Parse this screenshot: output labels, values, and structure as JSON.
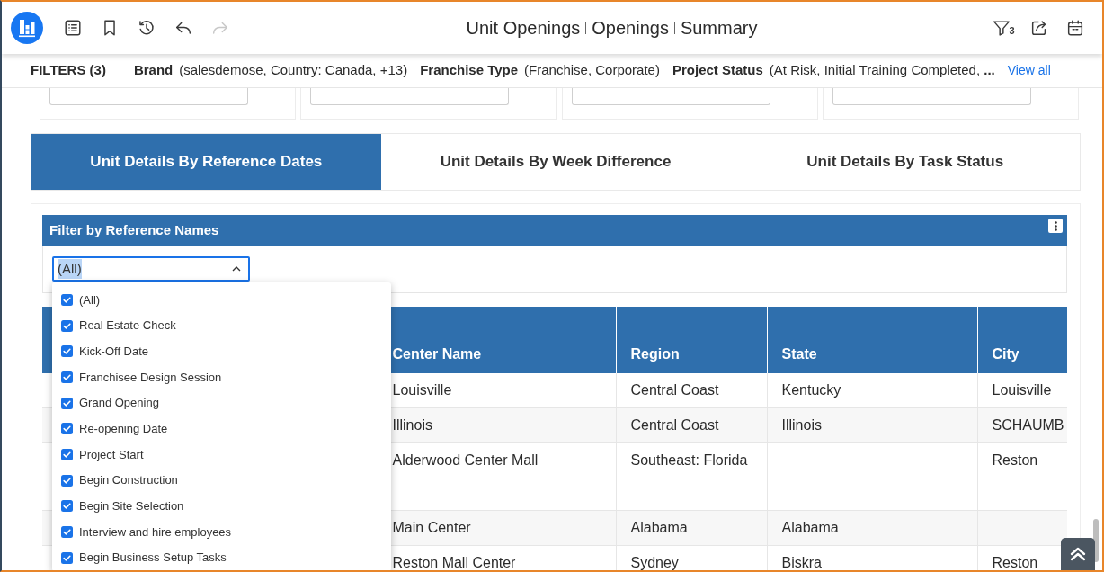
{
  "toolbar": {
    "buttons": [
      {
        "disabled": false
      },
      {
        "disabled": false
      },
      {
        "disabled": false
      },
      {
        "disabled": false
      },
      {
        "disabled": true
      }
    ]
  },
  "title": {
    "parts": [
      "Unit Openings",
      "Openings",
      "Summary"
    ]
  },
  "actions": {
    "filter_count": "3"
  },
  "filters": {
    "label": "FILTERS (3)",
    "items": [
      {
        "name": "Brand",
        "value": "(salesdemose, Country: Canada, +13)"
      },
      {
        "name": "Franchise Type",
        "value": "(Franchise, Corporate)"
      },
      {
        "name": "Project Status",
        "value": "(At Risk, Initial Training Completed, **...**"
      }
    ],
    "view_all": "View all"
  },
  "tabs": [
    {
      "label": "Unit Details By Reference Dates",
      "selected": true
    },
    {
      "label": "Unit Details By Week Difference",
      "selected": false
    },
    {
      "label": "Unit Details By Task Status",
      "selected": false
    }
  ],
  "reference_filter": {
    "title": "Filter by Reference Names",
    "select": {
      "value": "(All)",
      "expanded": true
    },
    "options": [
      {
        "label": "(All)",
        "checked": true
      },
      {
        "label": "Real Estate Check",
        "checked": true
      },
      {
        "label": "Kick-Off Date",
        "checked": true
      },
      {
        "label": "Franchisee Design Session",
        "checked": true
      },
      {
        "label": "Grand Opening",
        "checked": true
      },
      {
        "label": "Re-opening Date",
        "checked": true
      },
      {
        "label": "Project Start",
        "checked": true
      },
      {
        "label": "Begin Construction",
        "checked": true
      },
      {
        "label": "Begin Site Selection",
        "checked": true
      },
      {
        "label": "Interview and hire employees",
        "checked": true
      },
      {
        "label": "Begin Business Setup Tasks",
        "checked": true
      }
    ]
  },
  "table": {
    "columns": {
      "center_name": "Center Name",
      "region": "Region",
      "state": "State",
      "city": "City"
    },
    "rows": [
      {
        "center_name": "Louisville",
        "region": "Central Coast",
        "state": "Kentucky",
        "city": "Louisville"
      },
      {
        "center_name": "Illinois",
        "region": "Central Coast",
        "state": "Illinois",
        "city": "SCHAUMB"
      },
      {
        "center_name": "Alderwood Center Mall",
        "region": "Southeast: Florida",
        "city": "Reston"
      },
      {
        "center_name": "Main Center",
        "region": "Alabama",
        "state": "Alabama"
      },
      {
        "center_name": "Reston Mall Center",
        "region": "Sydney",
        "state": "Biskra",
        "city": "Reston"
      }
    ]
  }
}
